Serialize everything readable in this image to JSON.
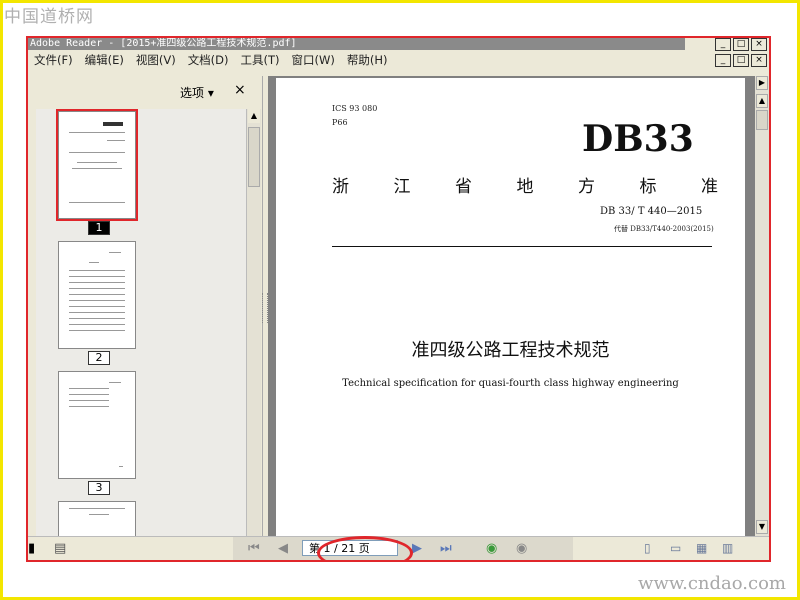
{
  "watermark": {
    "top_left": "中国道桥网",
    "bottom_right": "www.cndao.com"
  },
  "window": {
    "title": "Adobe Reader - [2015+准四级公路工程技术规范.pdf]",
    "controls": [
      "_",
      "□",
      "×"
    ]
  },
  "menu": {
    "items": [
      {
        "label": "文件(F)"
      },
      {
        "label": "编辑(E)"
      },
      {
        "label": "视图(V)"
      },
      {
        "label": "文档(D)"
      },
      {
        "label": "工具(T)"
      },
      {
        "label": "窗口(W)"
      },
      {
        "label": "帮助(H)"
      }
    ]
  },
  "pages_panel": {
    "options_label": "选项 ▾",
    "close_label": "×",
    "thumbnails": [
      {
        "label": "1",
        "selected": true
      },
      {
        "label": "2",
        "selected": false
      },
      {
        "label": "3",
        "selected": false
      }
    ]
  },
  "document": {
    "ics": "ICS 93 080",
    "p66": "P66",
    "db": "DB33",
    "province_chars": [
      "浙",
      "江",
      "省",
      "地",
      "方",
      "标",
      "准"
    ],
    "standard_no": "DB 33/ T 440—2015",
    "replaces": "代替 DB33/T440-2003(2015)",
    "title_cn": "准四级公路工程技术规范",
    "title_en": "Technical specification for quasi-fourth class highway engineering"
  },
  "statusbar": {
    "page_indicator": "第 1 / 21 页",
    "current_page": 1,
    "total_pages": 21
  },
  "colors": {
    "highlight_red": "#e0262b",
    "outer_frame_yellow": "#f3e600",
    "chrome": "#ece9d8",
    "doc_background": "#808080"
  }
}
